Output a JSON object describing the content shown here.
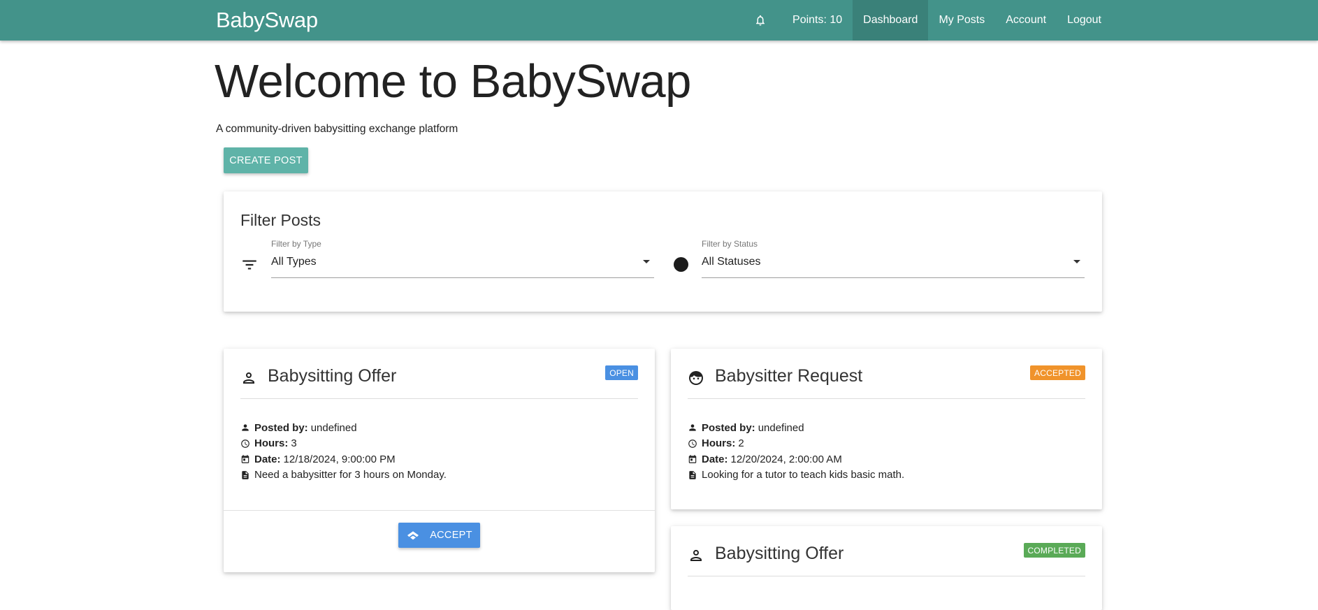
{
  "navbar": {
    "brand": "BabySwap",
    "points": "Points: 10",
    "links": [
      "Dashboard",
      "My Posts",
      "Account",
      "Logout"
    ],
    "active": "Dashboard",
    "bg_color": "#43938a"
  },
  "header": {
    "title": "Welcome to BabySwap",
    "tagline": "A community-driven babysitting exchange platform",
    "create_button": "CREATE POST"
  },
  "filter": {
    "title": "Filter Posts",
    "type_label": "Filter by Type",
    "type_value": "All Types",
    "status_label": "Filter by Status",
    "status_value": "All Statuses"
  },
  "posts": [
    {
      "icon": "person-icon",
      "title": "Babysitting Offer",
      "status": "OPEN",
      "status_color": "#4a90e2",
      "posted_by_label": "Posted by:",
      "posted_by": "undefined",
      "hours_label": "Hours:",
      "hours": "3",
      "date_label": "Date:",
      "date": "12/18/2024, 9:00:00 PM",
      "description": "Need a babysitter for 3 hours on Monday.",
      "action": "ACCEPT"
    },
    {
      "icon": "baby-face-icon",
      "title": "Babysitter Request",
      "status": "ACCEPTED",
      "status_color": "#f0932b",
      "posted_by_label": "Posted by:",
      "posted_by": "undefined",
      "hours_label": "Hours:",
      "hours": "2",
      "date_label": "Date:",
      "date": "12/20/2024, 2:00:00 AM",
      "description": "Looking for a tutor to teach kids basic math."
    },
    {
      "icon": "person-icon",
      "title": "Babysitting Offer",
      "status": "COMPLETED",
      "status_color": "#5aaa57"
    }
  ]
}
